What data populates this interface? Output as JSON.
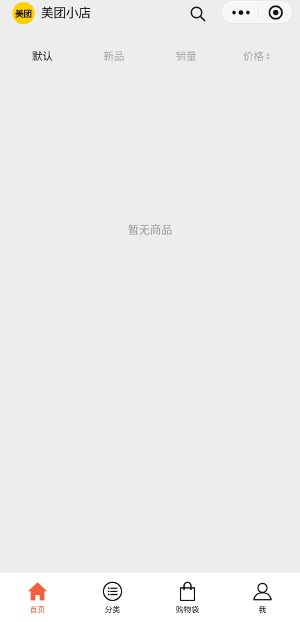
{
  "header": {
    "logo_text": "美团",
    "title": "美团小店"
  },
  "capsule": {
    "more_icon": "more-dots-icon",
    "close_icon": "target-close-icon"
  },
  "sort_tabs": [
    {
      "label": "默认",
      "active": true
    },
    {
      "label": "新品",
      "active": false
    },
    {
      "label": "销量",
      "active": false
    },
    {
      "label": "价格",
      "active": false
    }
  ],
  "empty_state": {
    "message": "暂无商品"
  },
  "bottom_nav": [
    {
      "label": "首页",
      "icon": "home-icon",
      "active": true
    },
    {
      "label": "分类",
      "icon": "list-icon",
      "active": false
    },
    {
      "label": "购物袋",
      "icon": "shopping-bag-icon",
      "active": false
    },
    {
      "label": "我",
      "icon": "user-icon",
      "active": false
    }
  ],
  "colors": {
    "accent": "#f2613f",
    "logo_bg": "#ffd100",
    "background": "#ededed"
  }
}
